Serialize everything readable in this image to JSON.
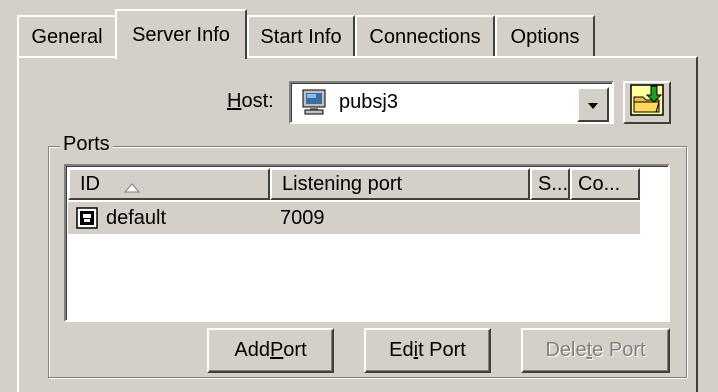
{
  "tabs": [
    {
      "label": "General",
      "active": false
    },
    {
      "label": "Server Info",
      "active": true
    },
    {
      "label": "Start Info",
      "active": false
    },
    {
      "label": "Connections",
      "active": false
    },
    {
      "label": "Options",
      "active": false
    }
  ],
  "host": {
    "label_first": "H",
    "label_rest": "ost:",
    "value": "pubsj3",
    "icon": "computer-icon",
    "browse_icon": "folder-browse-icon"
  },
  "ports": {
    "group_label": "Ports",
    "columns": [
      "ID",
      "Listening port",
      "S...",
      "Co..."
    ],
    "sort_column": "ID",
    "sort_direction": "ascending",
    "rows": [
      {
        "id": "default",
        "listening_port": "7009",
        "icon": "port-icon"
      }
    ]
  },
  "buttons": {
    "add": {
      "pre": "Add ",
      "key": "P",
      "post": "ort",
      "enabled": true
    },
    "edit": {
      "pre": "Ed",
      "key": "i",
      "post": "t Port",
      "enabled": true
    },
    "delete": {
      "pre": "Dele",
      "key": "t",
      "post": "e Port",
      "enabled": false
    }
  }
}
